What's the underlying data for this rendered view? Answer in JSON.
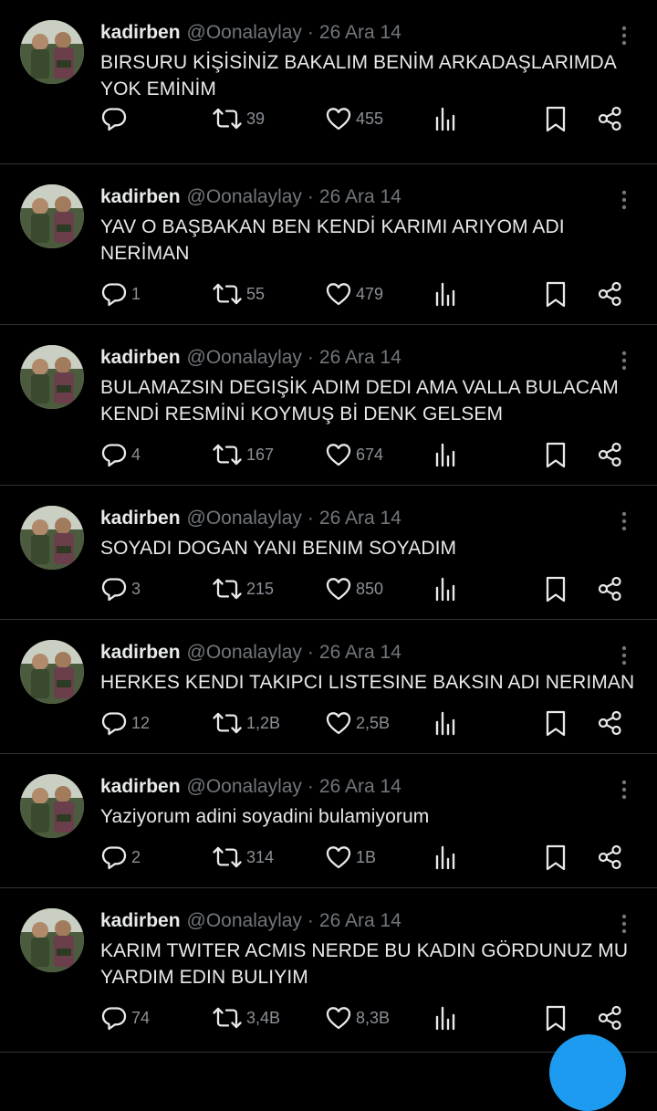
{
  "tweets": [
    {
      "name": "kadirben",
      "handle": "@Oonalaylay",
      "sep": "·",
      "time": "26 Ara 14",
      "text": "BIRSURU KİŞİSİNİZ BAKALIM BENİM ARKADAŞLARIMDA YOK EMİNİM",
      "replies": "",
      "retweets": "39",
      "likes": "455"
    },
    {
      "name": "kadirben",
      "handle": "@Oonalaylay",
      "sep": "·",
      "time": "26 Ara 14",
      "text": "YAV O BAŞBAKAN BEN KENDİ KARIMI ARIYOM ADI NERİMAN",
      "replies": "1",
      "retweets": "55",
      "likes": "479"
    },
    {
      "name": "kadirben",
      "handle": "@Oonalaylay",
      "sep": "·",
      "time": "26 Ara 14",
      "text": "BULAMAZSIN DEGIŞİK ADIM DEDI AMA VALLA BULACAM KENDİ RESMİNİ KOYMUŞ Bİ DENK GELSEM",
      "replies": "4",
      "retweets": "167",
      "likes": "674"
    },
    {
      "name": "kadirben",
      "handle": "@Oonalaylay",
      "sep": "·",
      "time": "26 Ara 14",
      "text": "SOYADI DOGAN YANI BENIM SOYADIM",
      "replies": "3",
      "retweets": "215",
      "likes": "850"
    },
    {
      "name": "kadirben",
      "handle": "@Oonalaylay",
      "sep": "·",
      "time": "26 Ara 14",
      "text": "HERKES KENDI TAKIPCI LISTESINE BAKSIN ADI NERIMAN",
      "replies": "12",
      "retweets": "1,2B",
      "likes": "2,5B"
    },
    {
      "name": "kadirben",
      "handle": "@Oonalaylay",
      "sep": "·",
      "time": "26 Ara 14",
      "text": "Yaziyorum adini soyadini bulamiyorum",
      "replies": "2",
      "retweets": "314",
      "likes": "1B"
    },
    {
      "name": "kadirben",
      "handle": "@Oonalaylay",
      "sep": "·",
      "time": "26 Ara 14",
      "text": "KARIM TWITER ACMIS NERDE BU KADIN GÖRDUNUZ MU YARDIM EDIN BULIYIM",
      "replies": "74",
      "retweets": "3,4B",
      "likes": "8,3B"
    }
  ],
  "icons": {
    "more": "more-vertical-icon",
    "reply": "reply-icon",
    "retweet": "retweet-icon",
    "like": "heart-icon",
    "views": "analytics-icon",
    "bookmark": "bookmark-icon",
    "share": "share-icon"
  },
  "colors": {
    "background": "#000000",
    "text": "#e7e9ea",
    "muted": "#71767b",
    "divider": "#2f3336",
    "accent": "#1d9bf0"
  }
}
